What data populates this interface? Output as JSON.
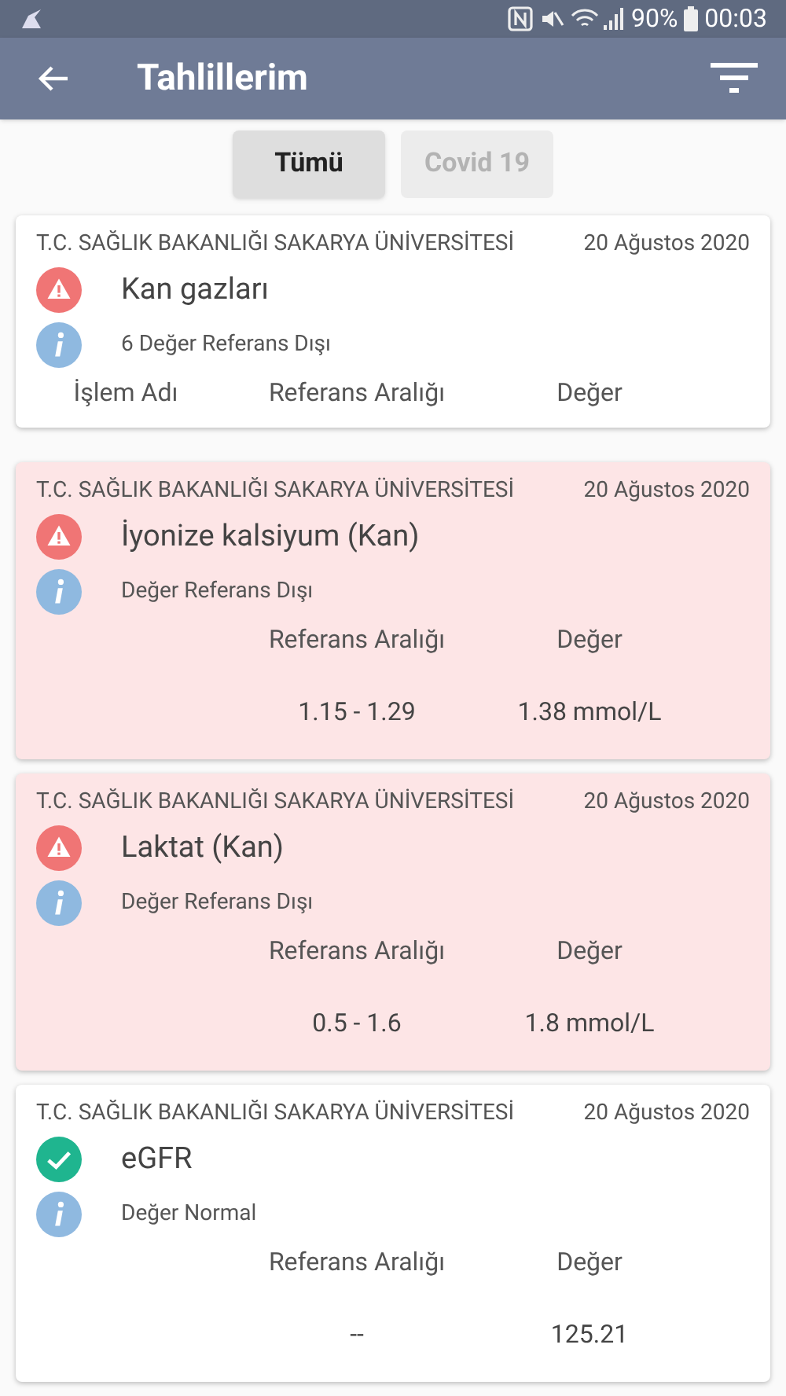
{
  "status_bar": {
    "battery": "90%",
    "time": "00:03"
  },
  "app_bar": {
    "title": "Tahlillerim"
  },
  "tabs": [
    {
      "label": "Tümü",
      "selected": true
    },
    {
      "label": "Covid 19",
      "selected": false
    }
  ],
  "results": [
    {
      "institution": "T.C. SAĞLIK BAKANLIĞI SAKARYA ÜNİVERSİTESİ",
      "date": "20 Ağustos 2020",
      "kind": "alert",
      "highlighted": false,
      "title": "Kan gazları",
      "note": "6 Değer Referans Dışı",
      "columns": [
        "İşlem Adı",
        "Referans Aralığı",
        "Değer"
      ]
    },
    {
      "institution": "T.C. SAĞLIK BAKANLIĞI SAKARYA ÜNİVERSİTESİ",
      "date": "20 Ağustos 2020",
      "kind": "alert",
      "highlighted": true,
      "title": "İyonize kalsiyum (Kan)",
      "note": "Değer Referans Dışı",
      "columns": [
        "Referans Aralığı",
        "Değer"
      ],
      "reference": "1.15 - 1.29",
      "value": "1.38 mmol/L"
    },
    {
      "institution": "T.C. SAĞLIK BAKANLIĞI SAKARYA ÜNİVERSİTESİ",
      "date": "20 Ağustos 2020",
      "kind": "alert",
      "highlighted": true,
      "title": "Laktat (Kan)",
      "note": "Değer Referans Dışı",
      "columns": [
        "Referans Aralığı",
        "Değer"
      ],
      "reference": "0.5 - 1.6",
      "value": "1.8 mmol/L"
    },
    {
      "institution": "T.C. SAĞLIK BAKANLIĞI SAKARYA ÜNİVERSİTESİ",
      "date": "20 Ağustos 2020",
      "kind": "normal",
      "highlighted": false,
      "title": "eGFR",
      "note": "Değer Normal",
      "columns": [
        "Referans Aralığı",
        "Değer"
      ],
      "reference": "--",
      "value": "125.21"
    }
  ]
}
